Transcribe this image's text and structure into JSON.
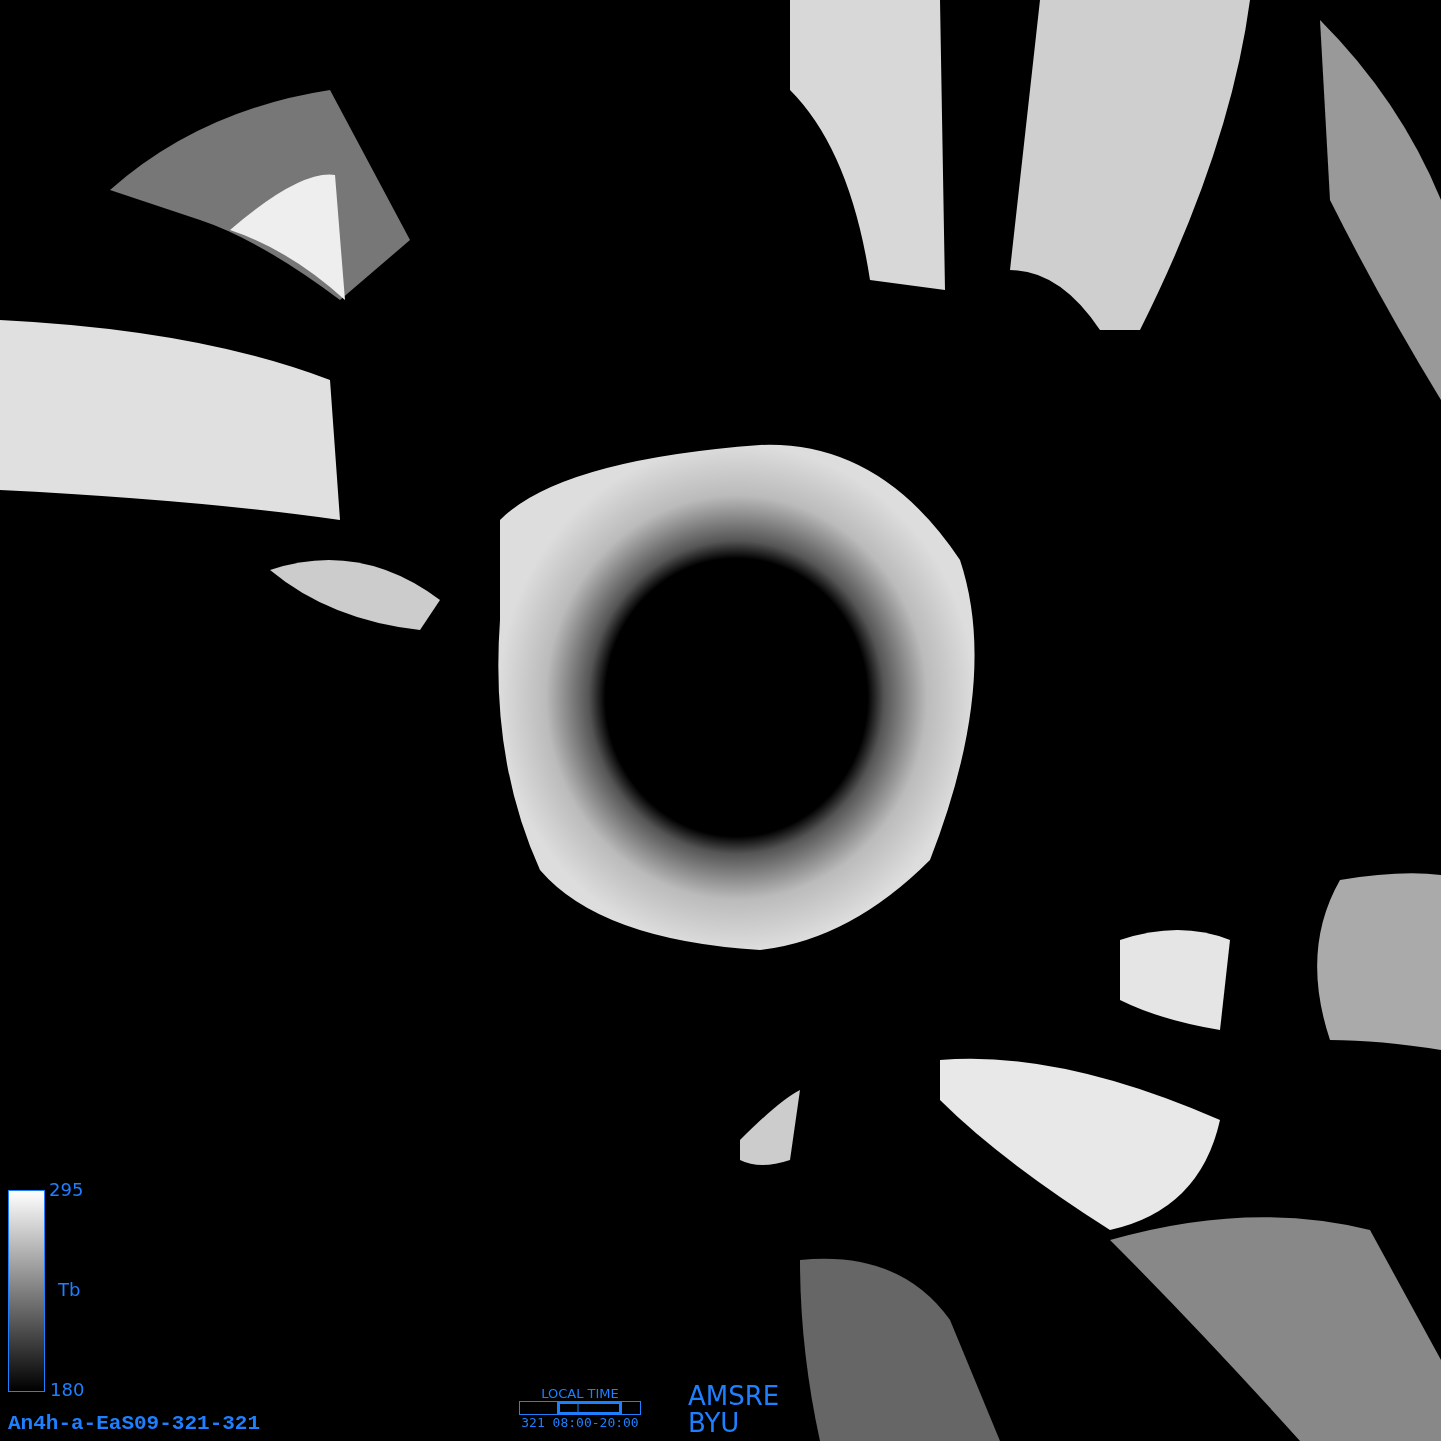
{
  "colorbar": {
    "max_label": "295",
    "quantity": "Tb",
    "min_label": "180"
  },
  "product_id": "An4h-a-EaS09-321-321",
  "local_time": {
    "title": "LOCAL TIME",
    "range": "321 08:00-20:00"
  },
  "credit": [
    "AMSRE",
    "BYU"
  ]
}
